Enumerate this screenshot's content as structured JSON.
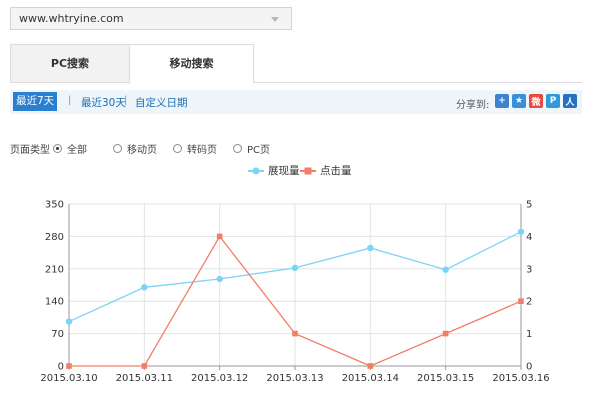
{
  "site_select": {
    "value": "www.whtryine.com"
  },
  "tabs": [
    {
      "label": "PC搜索",
      "active": false
    },
    {
      "label": "移动搜索",
      "active": true
    }
  ],
  "date_range": {
    "options": [
      "最近7天",
      "最近30天",
      "自定义日期"
    ],
    "active": "最近7天",
    "separator": "|"
  },
  "share": {
    "label": "分享到:",
    "icons": [
      {
        "name": "add-share-icon",
        "glyph": "+",
        "color": "#3b83d1"
      },
      {
        "name": "qzone-share-icon",
        "glyph": "★",
        "color": "#3a8fd8"
      },
      {
        "name": "weibo-share-icon",
        "glyph": "微",
        "color": "#e84b3c"
      },
      {
        "name": "tencent-weibo-share-icon",
        "glyph": "P",
        "color": "#2f9ad6"
      },
      {
        "name": "renren-share-icon",
        "glyph": "人",
        "color": "#2770c4"
      }
    ]
  },
  "page_type_filter": {
    "label": "页面类型",
    "options": [
      "全部",
      "移动页",
      "转码页",
      "PC页"
    ],
    "selected": "全部"
  },
  "chart_data": {
    "type": "line",
    "categories": [
      "2015.03.10",
      "2015.03.11",
      "2015.03.12",
      "2015.03.13",
      "2015.03.14",
      "2015.03.15",
      "2015.03.16"
    ],
    "series": [
      {
        "name": "展现量",
        "axis": "left",
        "color": "#7dd3f5",
        "marker": "circle",
        "values": [
          96,
          170,
          188,
          212,
          255,
          208,
          290
        ]
      },
      {
        "name": "点击量",
        "axis": "right",
        "color": "#f47c6a",
        "marker": "square",
        "values": [
          0,
          0,
          4,
          1,
          0,
          1,
          2
        ]
      }
    ],
    "y_left": {
      "ticks": [
        0,
        70,
        140,
        210,
        280,
        350
      ],
      "ylim": [
        0,
        350
      ]
    },
    "y_right": {
      "ticks": [
        0,
        1,
        2,
        3,
        4,
        5
      ],
      "ylim": [
        0,
        5
      ]
    },
    "grid": true,
    "legend_position": "top-center"
  }
}
